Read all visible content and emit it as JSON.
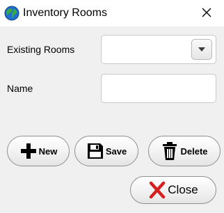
{
  "window": {
    "title": "Inventory Rooms"
  },
  "form": {
    "existing_rooms_label": "Existing Rooms",
    "existing_rooms_value": "",
    "name_label": "Name",
    "name_value": ""
  },
  "buttons": {
    "new_label": "New",
    "save_label": "Save",
    "delete_label": "Delete",
    "close_label": "Close"
  },
  "icons": {
    "app": "globe-icon",
    "new": "plus-icon",
    "save": "floppy-disk-icon",
    "delete": "trash-icon",
    "close": "red-x-icon"
  },
  "colors": {
    "close_icon": "#d62020",
    "globe_land": "#3aa845",
    "globe_water": "#1f6fd0"
  }
}
